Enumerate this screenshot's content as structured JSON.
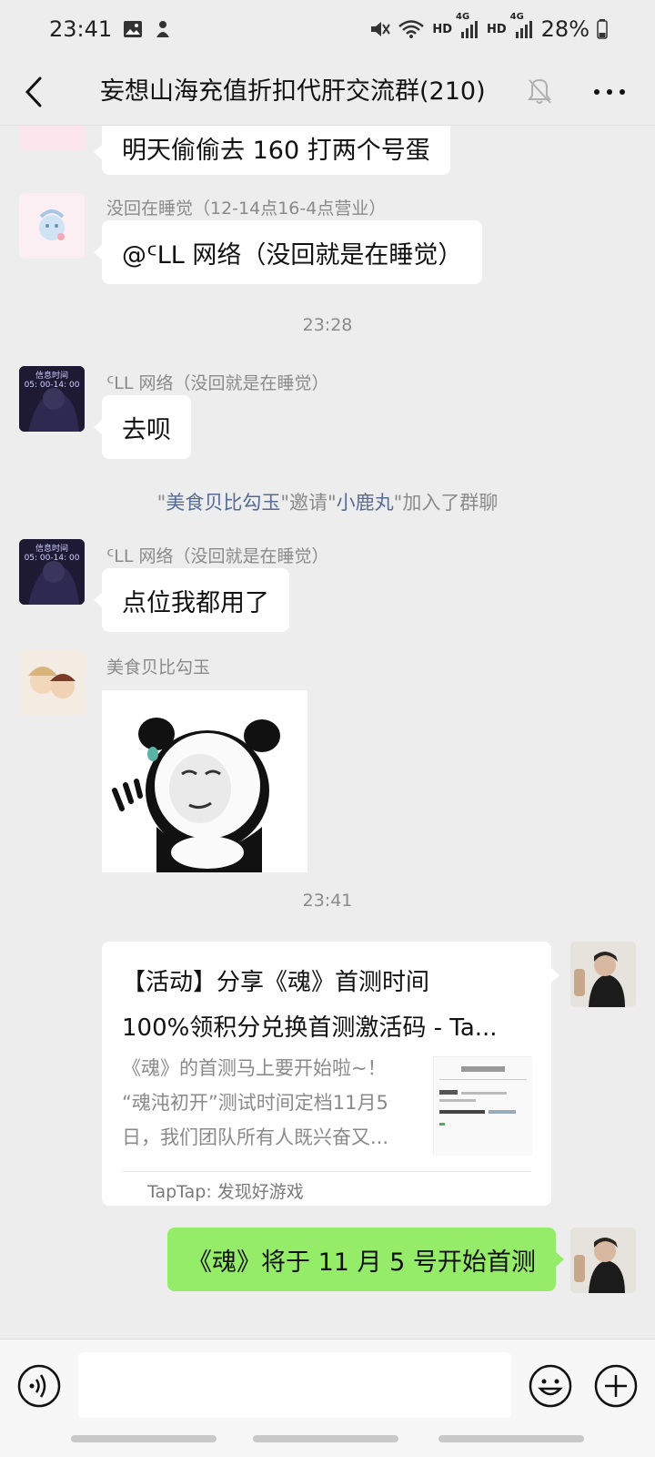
{
  "status_bar": {
    "time": "23:41",
    "battery": "28%",
    "hd1": "HD",
    "hd2": "HD",
    "net1": "4G",
    "net2": "4G"
  },
  "nav": {
    "title": "妄想山海充值折扣代肝交流群(210)"
  },
  "messages": {
    "m1": {
      "text": "明天偷偷去 160 打两个号蛋"
    },
    "m2": {
      "sender": "没回在睡觉（12-14点16-4点营业）",
      "text": "@ᑦLL 网络（没回就是在睡觉）"
    },
    "time1": "23:28",
    "m3": {
      "sender": "ᑦLL 网络（没回就是在睡觉）",
      "text": "去呗"
    },
    "system": {
      "q1": "\"",
      "inviter": "美食贝比勾玉",
      "mid": "\"邀请\"",
      "invitee": "小鹿丸",
      "end": "\"加入了群聊"
    },
    "m4": {
      "sender": "ᑦLL 网络（没回就是在睡觉）",
      "text": "点位我都用了"
    },
    "m5": {
      "sender": "美食贝比勾玉"
    },
    "time2": "23:41",
    "card": {
      "title_line1": "【活动】分享《魂》首测时间",
      "title_line2": "100%领积分兑换首测激活码 - Ta...",
      "desc_line1": "《魂》的首测马上要开始啦~！",
      "desc_line2": "“魂沌初开”测试时间定档11月5",
      "desc_line3": "日，我们团队所有人既兴奋又...",
      "source": "TapTap: 发现好游戏"
    },
    "m6": {
      "text": "《魂》将于 11 月 5 号开始首测"
    }
  },
  "avatars": {
    "clock_text1": "信息时间",
    "clock_text2": "05: 00-14: 00"
  },
  "input": {
    "value": "",
    "placeholder": ""
  },
  "colors": {
    "green_bubble": "#95ec69",
    "link_blue": "#576b95"
  }
}
